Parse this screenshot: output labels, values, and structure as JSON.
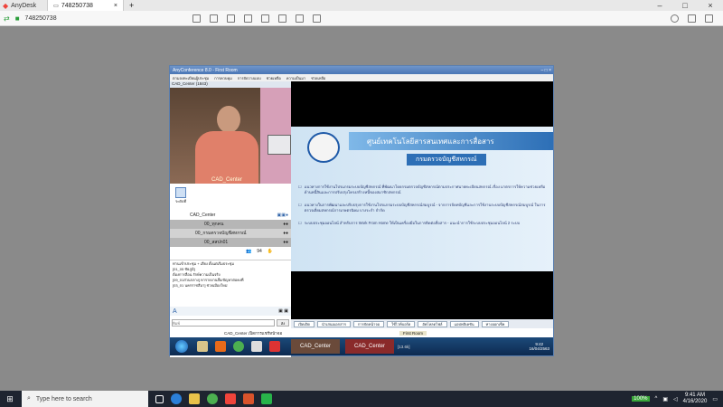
{
  "anydesk": {
    "app_name": "AnyDesk",
    "tab_label": "748250738",
    "address": "748250738",
    "new_tab": "+"
  },
  "conference": {
    "window_title": "AnyConference 8.0 - First Room",
    "menu": [
      "ตามลงทะเบียนผู้ประชุม",
      "การควบคุม",
      "การจัดวางแบบ",
      "ช่วยเหลือ",
      "ความเป็นมา",
      "ช่วยเหลือ"
    ],
    "camera_title": "CAD_Center (1843)",
    "camera_caption": "CAD_Center",
    "user_label": "ระดับที่",
    "participants": [
      {
        "name": "CAD_Center"
      },
      {
        "name": "00_ทุกคน"
      },
      {
        "name": "00_กรมตรวจบัญชีสหกรณ์"
      },
      {
        "name": "00_สสปก01"
      }
    ],
    "user_count": "94",
    "chat_lines": [
      "ท่านเข้าประชุม + เสียง ตั้งแต่เริ่มประชุม",
      "[01_05 ชัยภูมิ]",
      "ต้องการสื่อน รักษ์ความเป็นจริง",
      "[09_01ส่วนกลาง] หารายงานสื่อ/ปัญหาต่อคงที่",
      "[03_01 นครราชสีมา] ช่วยเมืองใหม่"
    ],
    "chat_placeholder": "พิมพ์",
    "send_label": "ส่ง",
    "slide_title": "ศูนย์เทคโนโลยีสารสนเทศและการสื่อสาร",
    "slide_subtitle": "กรมตรวจบัญชีสหกรณ์",
    "bullets": [
      "แนวทางการใช้งานโปรแกรมระบบบัญชีสหกรณ์ ที่พัฒนาโดยกรมตรวจบัญชีสหกรณ์ตามประกาศนายทะเบียนสหกรณ์ เรื่อง มาตรการให้ความช่วยเหลือด้านหนี้สินและการปรับปรุงโครงสร้างหนี้ของสมาชิกสหกรณ์",
      "แนวทางในการพัฒนาและปรับปรุงการใช้งานโปรแกรมระบบบัญชีสหกรณ์สมบูรณ์ - จากการจัดทบัญชีและการใช้งานระบบบัญชีสหกรณ์สมบูรณ์ ในการตรวจเยี่ยมสหกรณ์การเกษตรนิคม บางระกำ จำกัด",
      "ระบบประชุมออนไลน์ สำหรับการ Work From Home ให้เป็นเครื่องมือในการติดต่อสื่อสาร - แนะนำการใช้ระบบประชุมออนไลน์ 2 ระบบ"
    ],
    "bottom_tabs": [
      "เปิดเปิด",
      "นำเสนอเอกสาร",
      "การจัดหน้าจอ",
      "ใช้ไวท์บอร์ด",
      "อัพโหลดไฟล์",
      "แอปพลิเคชัน",
      "ทางออกเช็ค"
    ],
    "status_caption": "CAD_Center เปิดการแชร์หน้าจอ",
    "room_label": "First Room",
    "taskbar_items": [
      "CAD_Center",
      "CAD_Center"
    ],
    "task_size": "[13.6k]",
    "clock_time": "9:42",
    "clock_date": "16/04/2563"
  },
  "taskbar": {
    "search_placeholder": "Type here to search",
    "battery": "100%",
    "time": "9:41 AM",
    "date": "4/16/2020"
  },
  "colors": {
    "anydesk_red": "#ef443b",
    "slide_title_bar": "#2d6fb6",
    "taskbar_dark": "#1e2430"
  }
}
